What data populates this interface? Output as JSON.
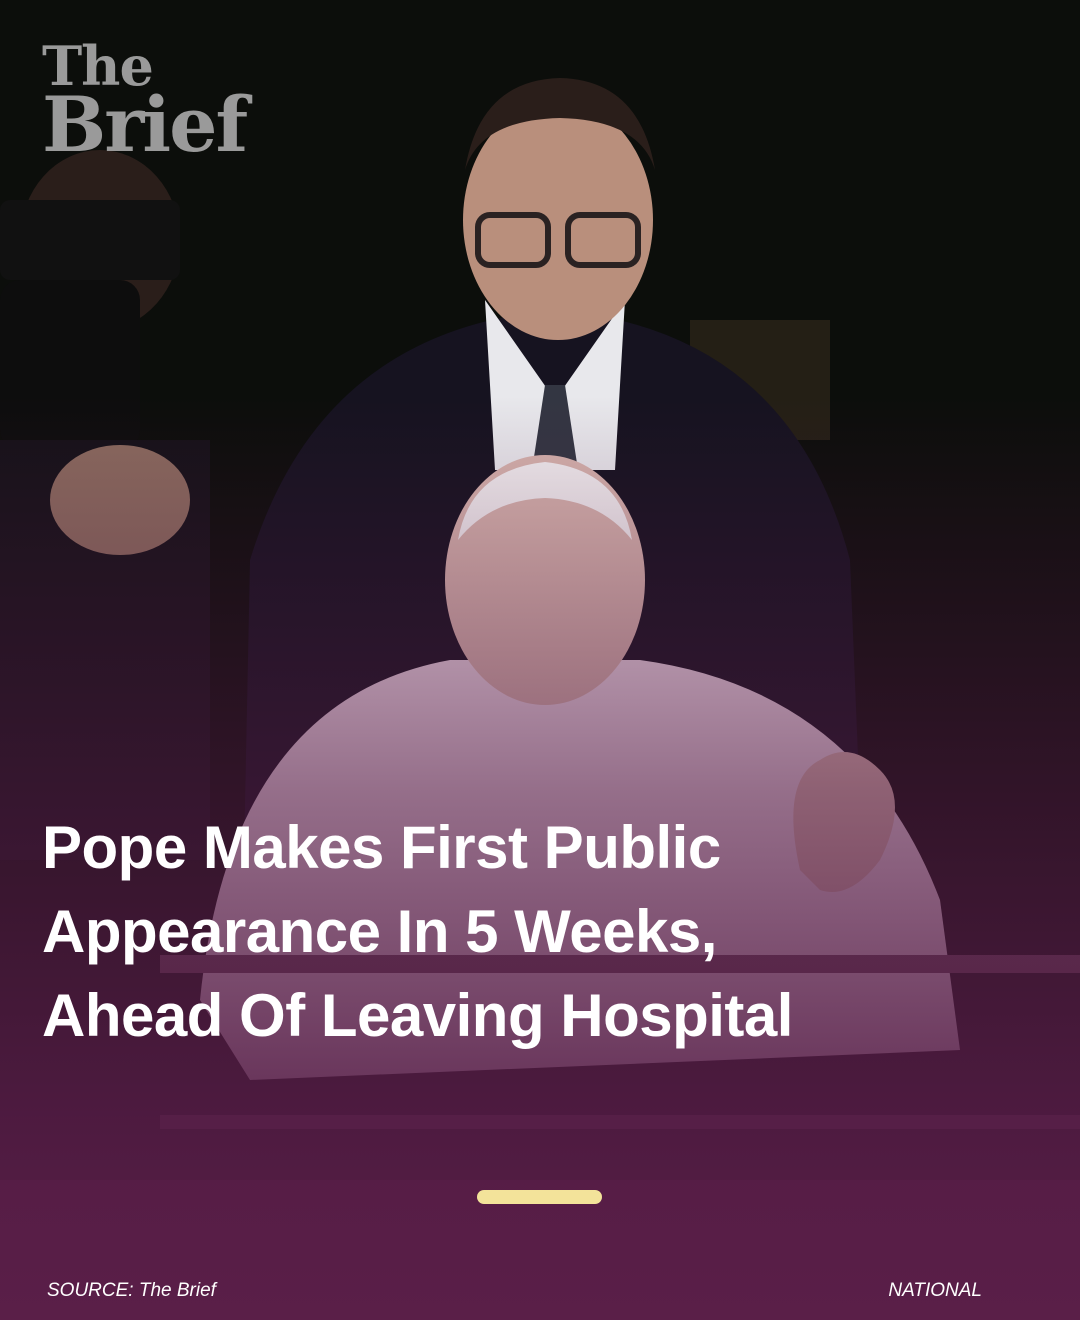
{
  "brand": {
    "line1": "The",
    "line2": "Brief"
  },
  "headline": {
    "lines": [
      "Pope Makes First Public",
      "Appearance In 5 Weeks,",
      "Ahead Of Leaving Hospital"
    ]
  },
  "pager": {
    "active_indicator_color": "#f3e39a"
  },
  "footer": {
    "source": "SOURCE: The Brief",
    "category": "NATIONAL"
  },
  "colors": {
    "background": "#5a1f48",
    "text": "#ffffff",
    "logo": "#9a9a9a"
  },
  "photo": {
    "icon": "news-photo"
  }
}
